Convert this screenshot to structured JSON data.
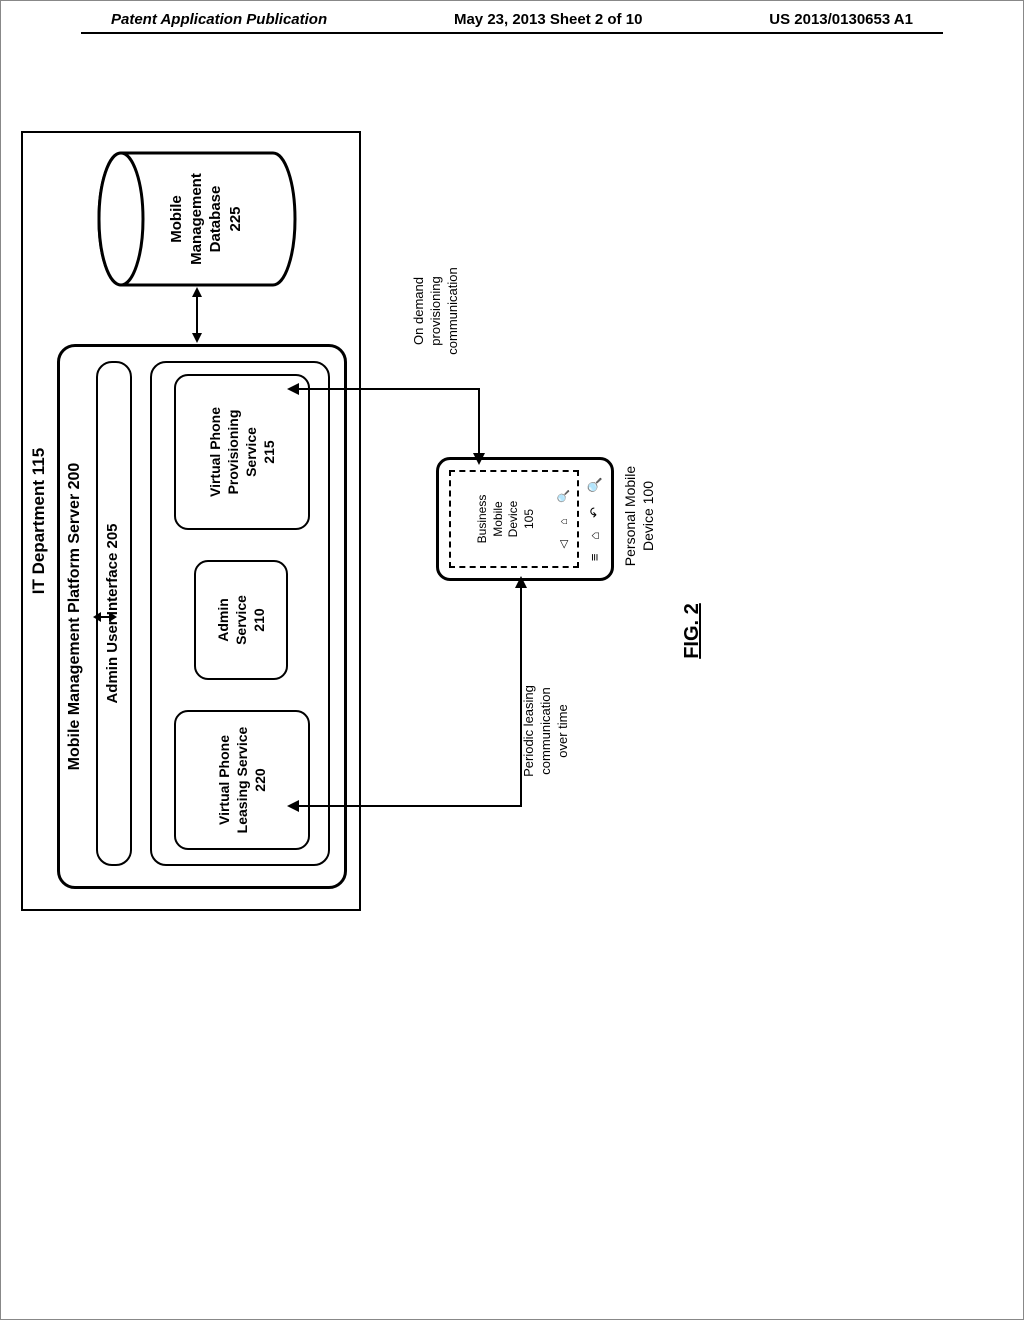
{
  "header": {
    "left": "Patent Application Publication",
    "center": "May 23, 2013  Sheet 2 of 10",
    "right": "US 2013/0130653 A1"
  },
  "diagram": {
    "it_dept": "IT Department 115",
    "mmps": "Mobile Management Platform Server 200",
    "admin_ui": "Admin User Interface 205",
    "svc_leasing_l1": "Virtual Phone",
    "svc_leasing_l2": "Leasing Service",
    "svc_leasing_l3": "220",
    "svc_admin_l1": "Admin",
    "svc_admin_l2": "Service",
    "svc_admin_l3": "210",
    "svc_prov_l1": "Virtual Phone",
    "svc_prov_l2": "Provisioning",
    "svc_prov_l3": "Service",
    "svc_prov_l4": "215",
    "db_l1": "Mobile",
    "db_l2": "Management",
    "db_l3": "Database",
    "db_l4": "225",
    "phone_inner_l1": "Business",
    "phone_inner_l2": "Mobile",
    "phone_inner_l3": "Device",
    "phone_inner_l4": "105",
    "phone_label_l1": "Personal Mobile",
    "phone_label_l2": "Device 100",
    "comm_left_l1": "Periodic leasing",
    "comm_left_l2": "communication",
    "comm_left_l3": "over time",
    "comm_right_l1": "On demand",
    "comm_right_l2": "provisioning",
    "comm_right_l3": "communication",
    "fig": "FIG. 2"
  }
}
